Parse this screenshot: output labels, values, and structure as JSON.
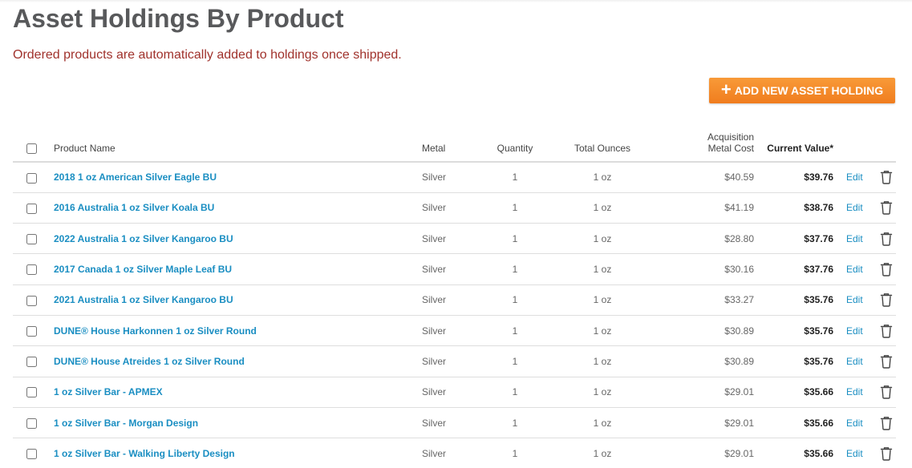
{
  "page": {
    "title": "Asset Holdings By Product",
    "notice": "Ordered products are automatically added to holdings once shipped.",
    "add_button_label": "ADD NEW ASSET HOLDING",
    "add_button_icon": "plus-icon",
    "accent_color": "#f08a24",
    "link_color": "#1a8ec2",
    "notice_color": "#a0322c"
  },
  "table": {
    "headers": {
      "product_name": "Product Name",
      "metal": "Metal",
      "quantity": "Quantity",
      "total_ounces": "Total Ounces",
      "acquisition_line1": "Acquisition",
      "acquisition_line2": "Metal Cost",
      "current_value": "Current Value*"
    },
    "edit_label": "Edit",
    "delete_icon": "trash-icon",
    "rows": [
      {
        "name": "2018 1 oz American Silver Eagle BU",
        "metal": "Silver",
        "quantity": "1",
        "ounces": "1 oz",
        "cost": "$40.59",
        "value": "$39.76"
      },
      {
        "name": "2016 Australia 1 oz Silver Koala BU",
        "metal": "Silver",
        "quantity": "1",
        "ounces": "1 oz",
        "cost": "$41.19",
        "value": "$38.76"
      },
      {
        "name": "2022 Australia 1 oz Silver Kangaroo BU",
        "metal": "Silver",
        "quantity": "1",
        "ounces": "1 oz",
        "cost": "$28.80",
        "value": "$37.76"
      },
      {
        "name": "2017 Canada 1 oz Silver Maple Leaf BU",
        "metal": "Silver",
        "quantity": "1",
        "ounces": "1 oz",
        "cost": "$30.16",
        "value": "$37.76"
      },
      {
        "name": "2021 Australia 1 oz Silver Kangaroo BU",
        "metal": "Silver",
        "quantity": "1",
        "ounces": "1 oz",
        "cost": "$33.27",
        "value": "$35.76"
      },
      {
        "name": "DUNE® House Harkonnen 1 oz Silver Round",
        "metal": "Silver",
        "quantity": "1",
        "ounces": "1 oz",
        "cost": "$30.89",
        "value": "$35.76"
      },
      {
        "name": "DUNE® House Atreides 1 oz Silver Round",
        "metal": "Silver",
        "quantity": "1",
        "ounces": "1 oz",
        "cost": "$30.89",
        "value": "$35.76"
      },
      {
        "name": "1 oz Silver Bar - APMEX",
        "metal": "Silver",
        "quantity": "1",
        "ounces": "1 oz",
        "cost": "$29.01",
        "value": "$35.66"
      },
      {
        "name": "1 oz Silver Bar - Morgan Design",
        "metal": "Silver",
        "quantity": "1",
        "ounces": "1 oz",
        "cost": "$29.01",
        "value": "$35.66"
      },
      {
        "name": "1 oz Silver Bar - Walking Liberty Design",
        "metal": "Silver",
        "quantity": "1",
        "ounces": "1 oz",
        "cost": "$29.01",
        "value": "$35.66"
      }
    ]
  }
}
